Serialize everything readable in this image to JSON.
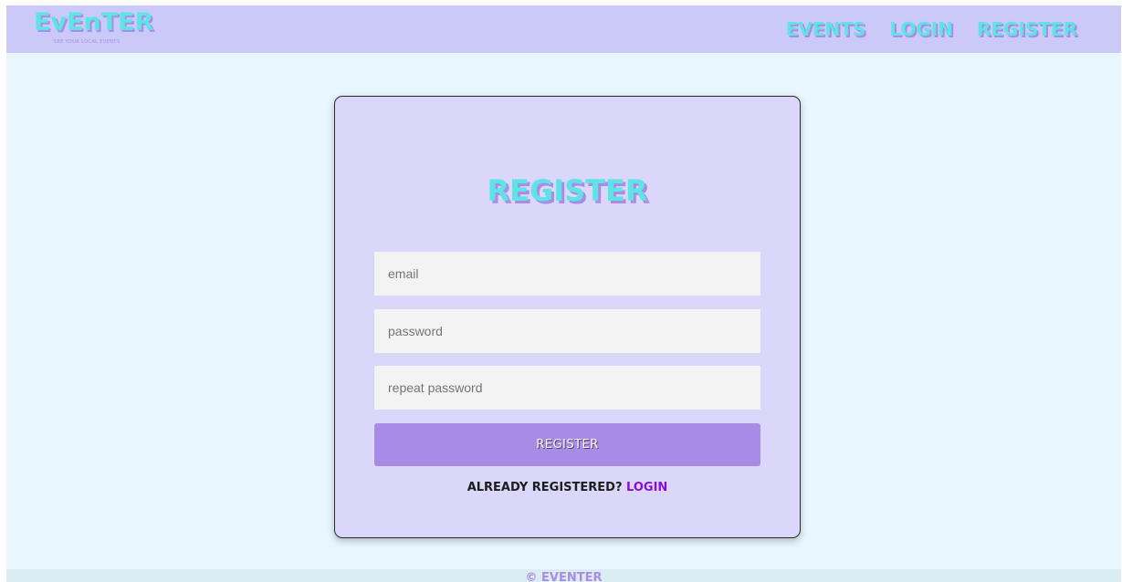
{
  "brand": {
    "name": "EvEnTER",
    "tagline": "see your local events",
    "primary_color": "#5ee3e6",
    "shadow_color": "#a98ce6"
  },
  "nav": {
    "items": [
      {
        "label": "Events"
      },
      {
        "label": "Login"
      },
      {
        "label": "Register"
      }
    ]
  },
  "form": {
    "title": "Register",
    "email_placeholder": "email",
    "password_placeholder": "password",
    "repeat_placeholder": "repeat password",
    "submit_label": "REGISTER",
    "already_text": "Already registered?",
    "login_link": "Login"
  },
  "footer": {
    "text": "© Eventer"
  }
}
